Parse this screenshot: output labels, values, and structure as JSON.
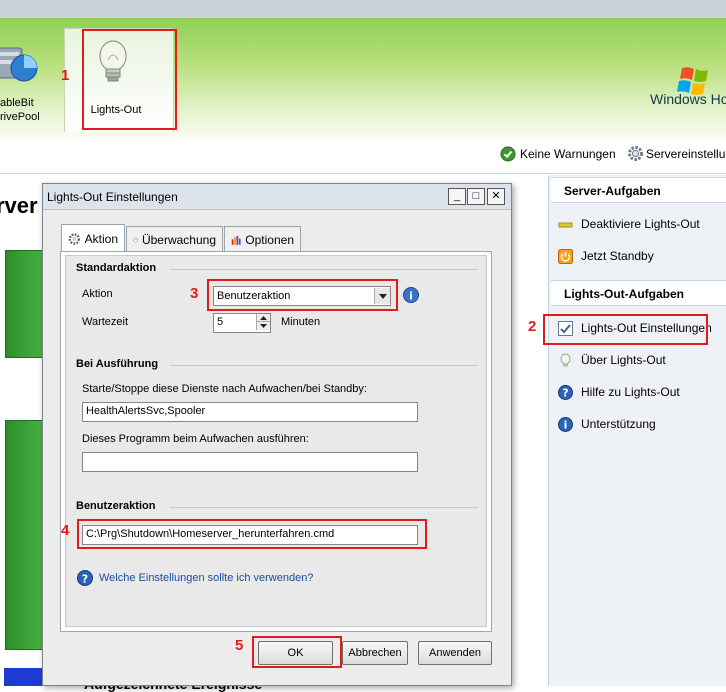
{
  "header": {
    "drivepool_label": "ableBit\nrivePool",
    "lights_out_tab": "Lights-Out",
    "windows_brand": "Windows Ho"
  },
  "status": {
    "warnings": "Keine Warnungen",
    "server_settings": "Servereinstellu"
  },
  "main": {
    "server_title": "rver",
    "events_title": "Aufgezeichnete Ereignisse"
  },
  "right_pane": {
    "server_tasks_header": "Server-Aufgaben",
    "server_tasks": [
      "Deaktiviere Lights-Out",
      "Jetzt Standby"
    ],
    "lo_tasks_header": "Lights-Out-Aufgaben",
    "lo_tasks": [
      "Lights-Out Einstellungen",
      "Über Lights-Out",
      "Hilfe zu Lights-Out",
      "Unterstützung"
    ]
  },
  "dialog": {
    "title": "Lights-Out Einstellungen",
    "window_buttons": [
      "_",
      "□",
      "✕"
    ],
    "tabs": [
      "Aktion",
      "Überwachung",
      "Optionen"
    ],
    "standard": {
      "title": "Standardaktion",
      "action_label": "Aktion",
      "action_value": "Benutzeraktion",
      "wait_label": "Wartezeit",
      "wait_value": "5",
      "wait_unit": "Minuten"
    },
    "execution": {
      "title": "Bei Ausführung",
      "services_label": "Starte/Stoppe diese Dienste nach Aufwachen/bei Standby:",
      "services_value": "HealthAlertsSvc,Spooler",
      "program_label": "Dieses Programm beim Aufwachen ausführen:",
      "program_value": ""
    },
    "user_action": {
      "title": "Benutzeraktion",
      "path_value": "C:\\Prg\\Shutdown\\Homeserver_herunterfahren.cmd"
    },
    "help_link": "Welche Einstellungen sollte ich verwenden?",
    "buttons": {
      "ok": "OK",
      "cancel": "Abbrechen",
      "apply": "Anwenden"
    }
  },
  "annotations": [
    "1",
    "2",
    "3",
    "4",
    "5"
  ],
  "colors": {
    "annotation_red": "#e21b1b",
    "header_green": "#8fcf54",
    "panel_bg": "#eef2f6"
  }
}
